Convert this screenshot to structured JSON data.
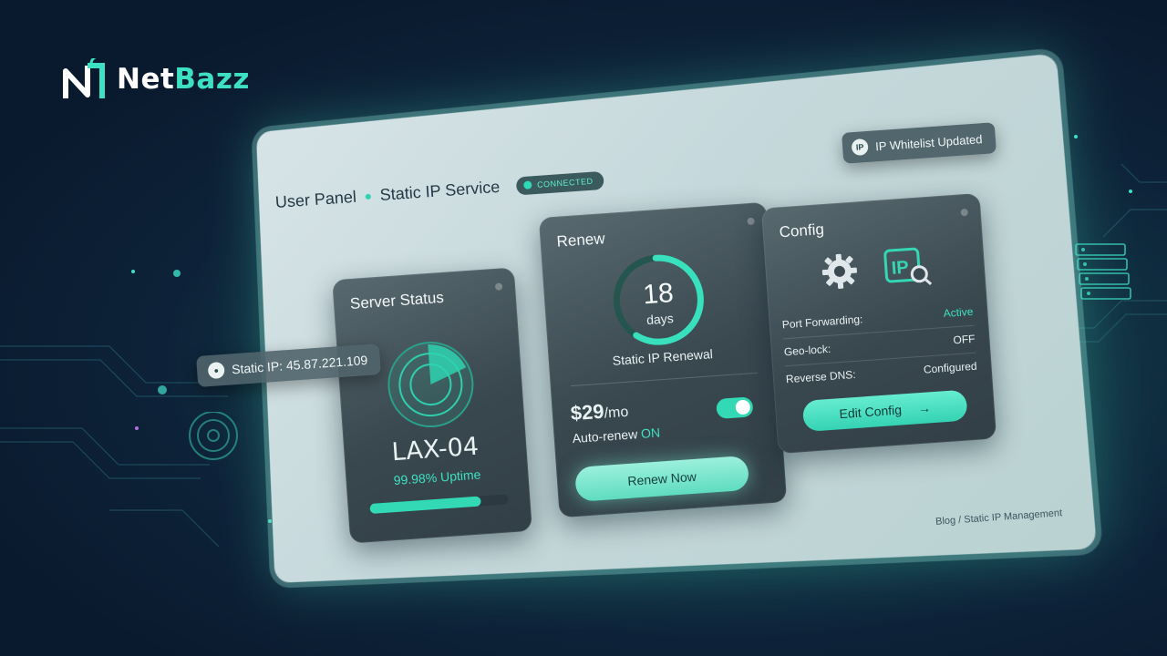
{
  "brand": {
    "name_part1": "Net",
    "name_part2": "Bazz",
    "logo_icon": "netbazz-logo-icon"
  },
  "header": {
    "crumb1": "User Panel",
    "crumb2": "Static IP Service",
    "status_badge": "CONNECTED"
  },
  "ip_chip": {
    "icon": "globe-icon",
    "label": "Static IP: 45.87.221.109"
  },
  "whitelist_chip": {
    "icon": "ip-icon",
    "icon_text": "IP",
    "label": "IP Whitelist Updated"
  },
  "server_card": {
    "title": "Server Status",
    "server": "LAX-04",
    "uptime": "99.98% Uptime",
    "uptime_fraction": 0.8
  },
  "renew_card": {
    "title": "Renew",
    "days_value": "18",
    "days_label": "days",
    "days_fraction": 0.6,
    "renewal_label": "Static IP Renewal",
    "price": "$29",
    "price_unit": "/mo",
    "autorenew_label": "Auto-renew",
    "autorenew_state": "ON",
    "renew_button": "Renew Now"
  },
  "config_card": {
    "title": "Config",
    "ip_icon_text": "IP",
    "rows": [
      {
        "label": "Port Forwarding:",
        "value": "Active"
      },
      {
        "label": "Geo-lock:",
        "value": "OFF"
      },
      {
        "label": "Reverse DNS:",
        "value": "Configured"
      }
    ],
    "edit_button": "Edit Config"
  },
  "footer": {
    "crumb1": "Blog",
    "separator": "/",
    "crumb2": "Static IP Management"
  },
  "colors": {
    "accent": "#33d8b5",
    "background": "#0d2238",
    "panel": "#c5d8db",
    "card": "#3a4850"
  }
}
